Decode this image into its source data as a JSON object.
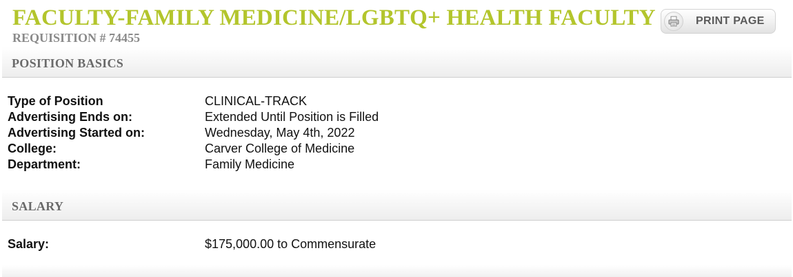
{
  "header": {
    "title": "FACULTY-FAMILY MEDICINE/LGBTQ+ HEALTH FACULTY",
    "requisition": "REQUISITION # 74455",
    "print_label": "PRINT PAGE"
  },
  "position_basics": {
    "heading": "POSITION BASICS",
    "rows": [
      {
        "label": "Type of Position",
        "value": "CLINICAL-TRACK"
      },
      {
        "label": "Advertising Ends on:",
        "value": "Extended Until Position is Filled"
      },
      {
        "label": "Advertising Started on:",
        "value": "Wednesday, May 4th, 2022"
      },
      {
        "label": "College:",
        "value": "Carver College of Medicine"
      },
      {
        "label": "Department:",
        "value": "Family Medicine"
      }
    ]
  },
  "salary": {
    "heading": "SALARY",
    "rows": [
      {
        "label": "Salary:",
        "value": "$175,000.00 to Commensurate"
      }
    ]
  },
  "colors": {
    "title": "#b3c52c",
    "requisition": "#8a8a8a",
    "section_heading": "#6a6a6a"
  },
  "icons": {
    "print": "printer-icon"
  }
}
